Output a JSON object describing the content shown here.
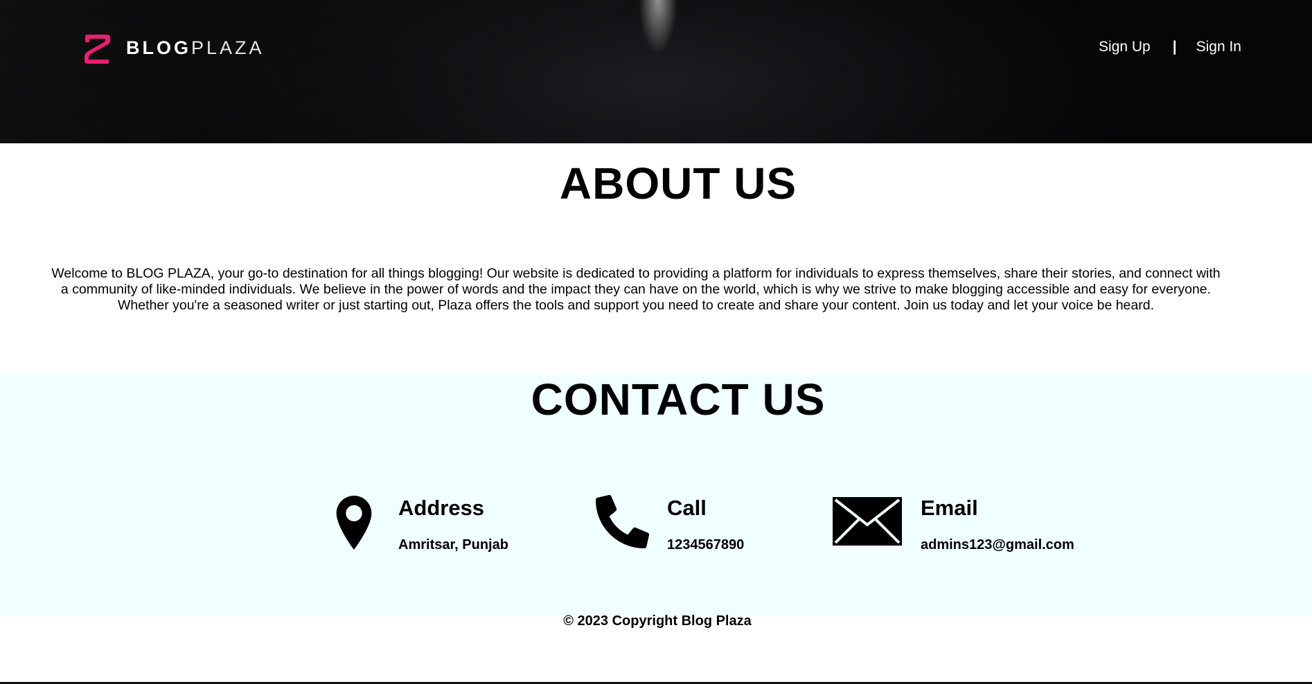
{
  "header": {
    "logo": {
      "part1": "BLOG",
      "part2": "PLAZA"
    },
    "nav": {
      "signup": "Sign Up",
      "separator": "|",
      "signin": "Sign In"
    }
  },
  "about": {
    "title": "ABOUT US",
    "text": "Welcome to BLOG PLAZA, your go-to destination for all things blogging! Our website is dedicated to providing a platform for individuals to express themselves, share their stories, and connect with a community of like-minded individuals. We believe in the power of words and the impact they can have on the world, which is why we strive to make blogging accessible and easy for everyone. Whether you're a seasoned writer or just starting out, Plaza offers the tools and support you need to create and share your content. Join us today and let your voice be heard."
  },
  "contact": {
    "title": "CONTACT US",
    "items": [
      {
        "icon": "location-pin-icon",
        "label": "Address",
        "value": "Amritsar, Punjab"
      },
      {
        "icon": "phone-icon",
        "label": "Call",
        "value": "1234567890"
      },
      {
        "icon": "envelope-icon",
        "label": "Email",
        "value": "admins123@gmail.com"
      }
    ]
  },
  "footer": {
    "copyright": "© 2023 Copyright Blog Plaza"
  },
  "colors": {
    "brand_pink": "#e8186d",
    "hero_bg": "#0d0d10",
    "contact_bg": "#f0ffff"
  }
}
